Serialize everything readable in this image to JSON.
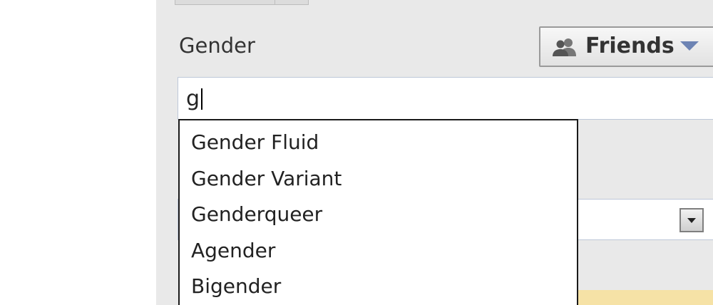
{
  "form": {
    "gender_label": "Gender",
    "gender_input_value": "g"
  },
  "privacy": {
    "label": "Friends",
    "icon": "friends-icon",
    "caret_color": "#6d84b4"
  },
  "suggestions": [
    "Gender Fluid",
    "Gender Variant",
    "Genderqueer",
    "Agender",
    "Bigender"
  ]
}
